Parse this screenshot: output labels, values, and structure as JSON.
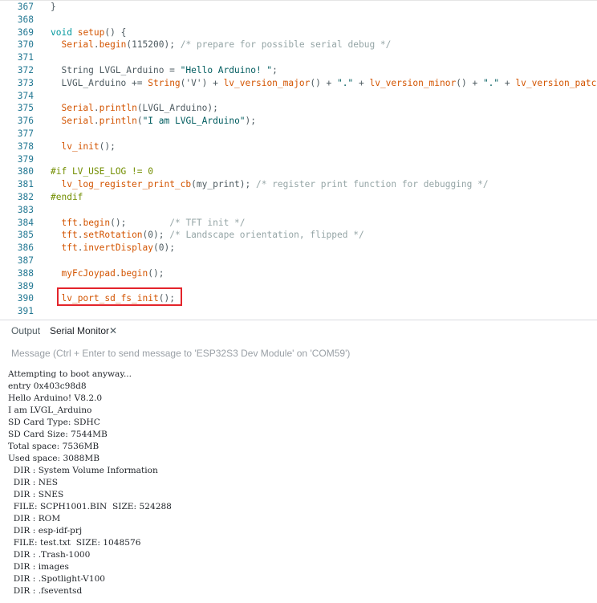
{
  "editor": {
    "lines": [
      {
        "n": "367",
        "segs": [
          [
            "}",
            "p"
          ]
        ]
      },
      {
        "n": "368",
        "segs": []
      },
      {
        "n": "369",
        "segs": [
          [
            "void",
            "kw"
          ],
          [
            " ",
            "p"
          ],
          [
            "setup",
            "fn"
          ],
          [
            "() {",
            "p"
          ]
        ]
      },
      {
        "n": "370",
        "segs": [
          [
            "  ",
            "p"
          ],
          [
            "Serial",
            "fn"
          ],
          [
            ".",
            "p"
          ],
          [
            "begin",
            "fn"
          ],
          [
            "(115200); ",
            "p"
          ],
          [
            "/* prepare for possible serial debug */",
            "cm"
          ]
        ]
      },
      {
        "n": "371",
        "segs": []
      },
      {
        "n": "372",
        "segs": [
          [
            "  String LVGL_Arduino = ",
            "p"
          ],
          [
            "\"Hello Arduino! \"",
            "st"
          ],
          [
            ";",
            "p"
          ]
        ]
      },
      {
        "n": "373",
        "segs": [
          [
            "  LVGL_Arduino += ",
            "p"
          ],
          [
            "String",
            "fn"
          ],
          [
            "('V') + ",
            "p"
          ],
          [
            "lv_version_major",
            "fn"
          ],
          [
            "() + ",
            "p"
          ],
          [
            "\".\"",
            "st"
          ],
          [
            " + ",
            "p"
          ],
          [
            "lv_version_minor",
            "fn"
          ],
          [
            "() + ",
            "p"
          ],
          [
            "\".\"",
            "st"
          ],
          [
            " + ",
            "p"
          ],
          [
            "lv_version_patch",
            "fn"
          ],
          [
            "();",
            "p"
          ]
        ]
      },
      {
        "n": "374",
        "segs": []
      },
      {
        "n": "375",
        "segs": [
          [
            "  ",
            "p"
          ],
          [
            "Serial",
            "fn"
          ],
          [
            ".",
            "p"
          ],
          [
            "println",
            "fn"
          ],
          [
            "(LVGL_Arduino);",
            "p"
          ]
        ]
      },
      {
        "n": "376",
        "segs": [
          [
            "  ",
            "p"
          ],
          [
            "Serial",
            "fn"
          ],
          [
            ".",
            "p"
          ],
          [
            "println",
            "fn"
          ],
          [
            "(",
            "p"
          ],
          [
            "\"I am LVGL_Arduino\"",
            "st"
          ],
          [
            ");",
            "p"
          ]
        ]
      },
      {
        "n": "377",
        "segs": []
      },
      {
        "n": "378",
        "segs": [
          [
            "  ",
            "p"
          ],
          [
            "lv_init",
            "fn"
          ],
          [
            "();",
            "p"
          ]
        ]
      },
      {
        "n": "379",
        "segs": []
      },
      {
        "n": "380",
        "segs": [
          [
            "#if LV_USE_LOG != 0",
            "pp"
          ]
        ]
      },
      {
        "n": "381",
        "segs": [
          [
            "  ",
            "p"
          ],
          [
            "lv_log_register_print_cb",
            "fn"
          ],
          [
            "(my_print); ",
            "p"
          ],
          [
            "/* register print function for debugging */",
            "cm"
          ]
        ]
      },
      {
        "n": "382",
        "segs": [
          [
            "#endif",
            "pp"
          ]
        ]
      },
      {
        "n": "383",
        "segs": []
      },
      {
        "n": "384",
        "segs": [
          [
            "  ",
            "p"
          ],
          [
            "tft",
            "fn"
          ],
          [
            ".",
            "p"
          ],
          [
            "begin",
            "fn"
          ],
          [
            "();        ",
            "p"
          ],
          [
            "/* TFT init */",
            "cm"
          ]
        ]
      },
      {
        "n": "385",
        "segs": [
          [
            "  ",
            "p"
          ],
          [
            "tft",
            "fn"
          ],
          [
            ".",
            "p"
          ],
          [
            "setRotation",
            "fn"
          ],
          [
            "(0); ",
            "p"
          ],
          [
            "/* Landscape orientation, flipped */",
            "cm"
          ]
        ]
      },
      {
        "n": "386",
        "segs": [
          [
            "  ",
            "p"
          ],
          [
            "tft",
            "fn"
          ],
          [
            ".",
            "p"
          ],
          [
            "invertDisplay",
            "fn"
          ],
          [
            "(0);",
            "p"
          ]
        ]
      },
      {
        "n": "387",
        "segs": []
      },
      {
        "n": "388",
        "segs": [
          [
            "  ",
            "p"
          ],
          [
            "myFcJoypad",
            "fn"
          ],
          [
            ".",
            "p"
          ],
          [
            "begin",
            "fn"
          ],
          [
            "();",
            "p"
          ]
        ]
      },
      {
        "n": "389",
        "segs": []
      },
      {
        "n": "390",
        "segs": [
          [
            "  ",
            "p"
          ],
          [
            "lv_port_sd_fs_init",
            "fn"
          ],
          [
            "();",
            "p"
          ]
        ]
      },
      {
        "n": "391",
        "segs": []
      }
    ],
    "highlight_color": "#e3242b"
  },
  "panel": {
    "tabs": {
      "output": "Output",
      "serial_monitor": "Serial Monitor",
      "close": "✕"
    },
    "message_placeholder": "Message (Ctrl + Enter to send message to 'ESP32S3 Dev Module' on 'COM59')",
    "serial_lines": [
      "Attempting to boot anyway...",
      "entry 0x403c98d8",
      "Hello Arduino! V8.2.0",
      "I am LVGL_Arduino",
      "SD Card Type: SDHC",
      "SD Card Size: 7544MB",
      "Total space: 7536MB",
      "Used space: 3088MB",
      "  DIR : System Volume Information",
      "  DIR : NES",
      "  DIR : SNES",
      "  FILE: SCPH1001.BIN  SIZE: 524288",
      "  DIR : ROM",
      "  DIR : esp-idf-prj",
      "  FILE: test.txt  SIZE: 1048576",
      "  DIR : .Trash-1000",
      "  DIR : images",
      "  DIR : .Spotlight-V100",
      "  DIR : .fseventsd"
    ]
  }
}
